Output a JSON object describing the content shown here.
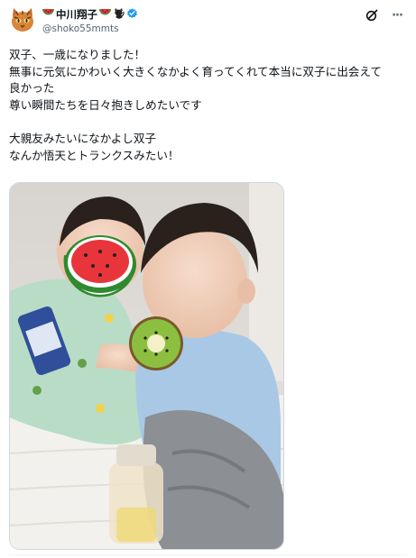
{
  "author": {
    "display_name": "中川翔子",
    "handle": "@shoko55mmts",
    "name_emojis": [
      "watermelon-emoji",
      "watermelon-emoji",
      "black-cat-emoji"
    ],
    "verified_color": "#1d9bf0"
  },
  "actions": {
    "grok_icon": "grok-icon",
    "more_icon": "more-horizontal-icon",
    "more_label": "···"
  },
  "tweet": {
    "lines": [
      "双子、一歳になりました！",
      "無事に元気にかわいく大きくなかよく育ってくれて本当に双子に出会えて",
      "良かった",
      "尊い瞬間たちを日々抱きしめたいです",
      "",
      "大親友みたいになかよし双子",
      "なんか悟天とトランクスみたい！"
    ]
  },
  "media": {
    "alt": "photo of twin babies with watermelon and kiwi stickers over faces",
    "stickers": [
      "watermelon-sticker",
      "kiwi-sticker"
    ]
  },
  "colors": {
    "text": "#0f1419",
    "secondary": "#536471",
    "border": "#cfd9de"
  }
}
